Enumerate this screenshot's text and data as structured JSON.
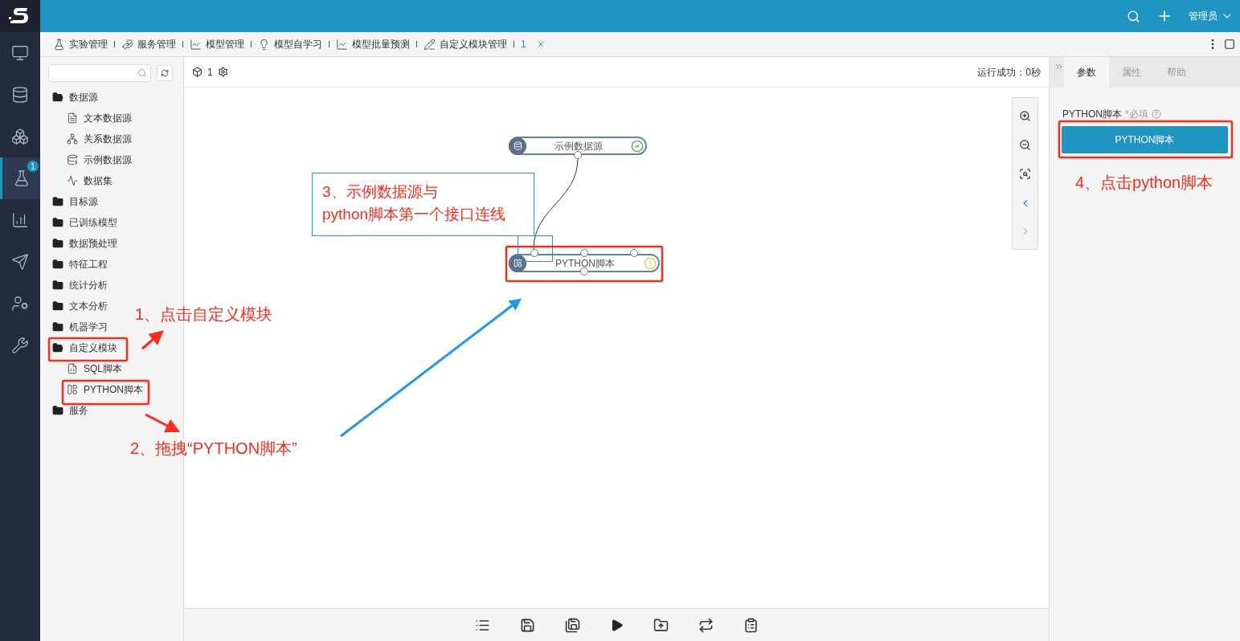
{
  "nav": [
    {
      "selected": false
    },
    {
      "selected": false
    },
    {
      "selected": false
    },
    {
      "selected": true,
      "badge": "1"
    },
    {
      "selected": false
    },
    {
      "selected": false
    },
    {
      "selected": false
    },
    {
      "selected": false
    }
  ],
  "header": {
    "user": "管理员"
  },
  "tabs": [
    {
      "label": "实验管理",
      "selected": false
    },
    {
      "label": "服务管理",
      "selected": false
    },
    {
      "label": "模型管理",
      "selected": false
    },
    {
      "label": "模型自学习",
      "selected": false
    },
    {
      "label": "模型批量预测",
      "selected": false
    },
    {
      "label": "自定义模块管理",
      "selected": false
    },
    {
      "label": "1",
      "selected": true,
      "closable": true
    }
  ],
  "tree": [
    {
      "label": "数据源",
      "expanded": true,
      "children": [
        {
          "label": "文本数据源"
        },
        {
          "label": "关系数据源"
        },
        {
          "label": "示例数据源"
        },
        {
          "label": "数据集"
        }
      ]
    },
    {
      "label": "目标源",
      "expanded": false
    },
    {
      "label": "已训练模型",
      "expanded": false
    },
    {
      "label": "数据预处理",
      "expanded": false
    },
    {
      "label": "特征工程",
      "expanded": false
    },
    {
      "label": "统计分析",
      "expanded": false
    },
    {
      "label": "文本分析",
      "expanded": false
    },
    {
      "label": "机器学习",
      "expanded": false
    },
    {
      "label": "自定义模块",
      "expanded": true,
      "children": [
        {
          "label": "SQL脚本"
        },
        {
          "label": "PYTHON脚本"
        }
      ]
    },
    {
      "label": "服务",
      "expanded": false
    }
  ],
  "canvas": {
    "experiment": "1",
    "status": "运行成功：0秒",
    "nodes": [
      {
        "label": "示例数据源",
        "kind": "ok"
      },
      {
        "label": "PYTHON脚本",
        "kind": "warning"
      }
    ]
  },
  "right_panel": {
    "tabs": [
      {
        "label": "参数",
        "selected": true
      },
      {
        "label": "属性",
        "selected": false
      },
      {
        "label": "帮助",
        "selected": false
      }
    ],
    "field_label": "PYTHON脚本",
    "required": "*必填",
    "button": "PYTHON脚本"
  },
  "annotations": [
    "1、点击自定义模块",
    "2、拖拽“PYTHON脚本”",
    "3、示例数据源与\npython脚本第一个接口连线",
    "4、点击python脚本"
  ]
}
